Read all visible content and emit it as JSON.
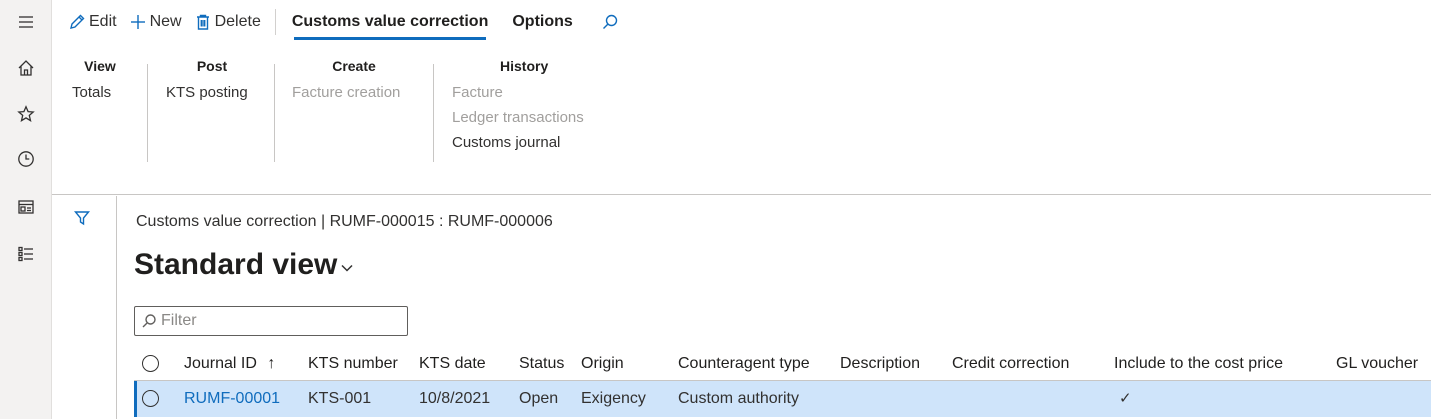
{
  "actions": {
    "edit": "Edit",
    "new": "New",
    "delete": "Delete",
    "tab_active": "Customs value correction",
    "tab_options": "Options"
  },
  "ribbon": {
    "view": {
      "header": "View",
      "items": [
        "Totals"
      ]
    },
    "post": {
      "header": "Post",
      "items": [
        "KTS posting"
      ]
    },
    "create": {
      "header": "Create",
      "items": [
        "Facture creation"
      ]
    },
    "history": {
      "header": "History",
      "items": [
        "Facture",
        "Ledger transactions",
        "Customs journal"
      ]
    }
  },
  "page": {
    "caption": "Customs value correction  |  RUMF-000015 : RUMF-000006",
    "view_title": "Standard view",
    "filter_placeholder": "Filter"
  },
  "grid": {
    "columns": [
      "Journal ID",
      "KTS number",
      "KTS date",
      "Status",
      "Origin",
      "Counteragent type",
      "Description",
      "Credit correction",
      "Include to the cost price",
      "GL voucher"
    ],
    "sort_indicator": "↑",
    "rows": [
      {
        "journal_id": "RUMF-00001",
        "kts_number": "KTS-001",
        "kts_date": "10/8/2021",
        "status": "Open",
        "origin": "Exigency",
        "counteragent_type": "Custom authority",
        "description": "",
        "credit_correction": "",
        "include_cost_price": "✓",
        "gl_voucher": ""
      }
    ]
  },
  "colors": {
    "accent": "#0f6cbd",
    "selected_row": "#cfe4fa",
    "disabled_text": "#a19f9d"
  }
}
